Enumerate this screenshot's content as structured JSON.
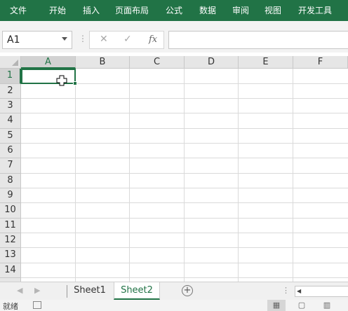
{
  "ribbon": {
    "tabs": [
      "文件",
      "开始",
      "插入",
      "页面布局",
      "公式",
      "数据",
      "审阅",
      "视图",
      "开发工具"
    ]
  },
  "formula_bar": {
    "name_box": "A1",
    "formula": ""
  },
  "sheet": {
    "columns": [
      "A",
      "B",
      "C",
      "D",
      "E",
      "F"
    ],
    "rows": [
      "1",
      "2",
      "3",
      "4",
      "5",
      "6",
      "7",
      "8",
      "9",
      "10",
      "11",
      "12",
      "13",
      "14"
    ],
    "selected_cell": "A1"
  },
  "tabs": {
    "sheets": [
      "Sheet1",
      "Sheet2"
    ],
    "active": "Sheet2"
  },
  "status": {
    "text": "就绪"
  },
  "colors": {
    "accent": "#217346"
  }
}
